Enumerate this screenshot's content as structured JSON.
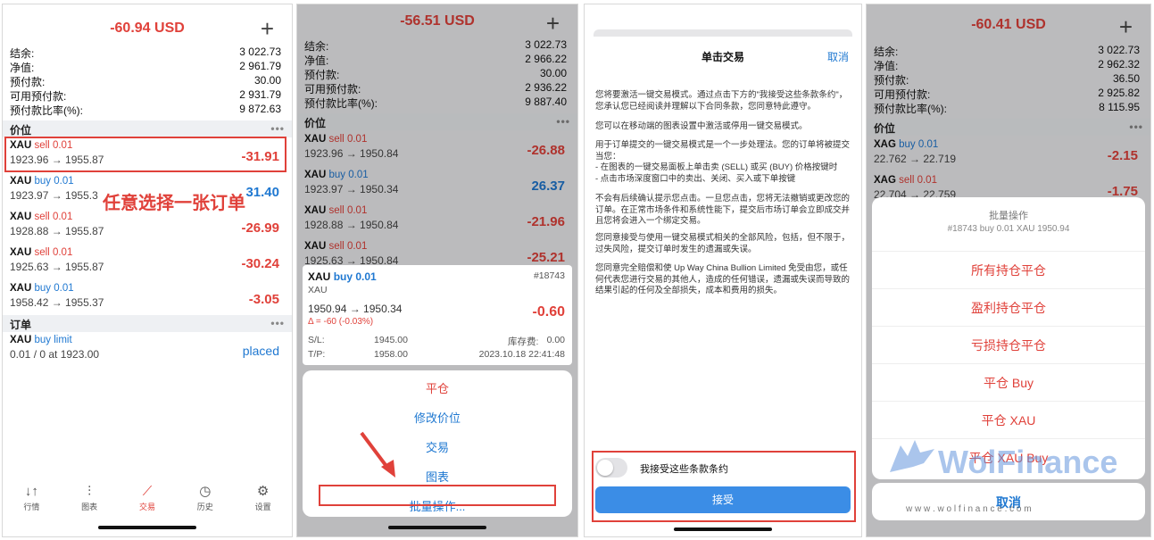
{
  "p1": {
    "title": "-60.94 USD",
    "plus": "+",
    "stats": [
      {
        "k": "结余:",
        "v": "3 022.73"
      },
      {
        "k": "净值:",
        "v": "2 961.79"
      },
      {
        "k": "预付款:",
        "v": "30.00"
      },
      {
        "k": "可用预付款:",
        "v": "2 931.79"
      },
      {
        "k": "预付款比率(%):",
        "v": "9 872.63"
      }
    ],
    "sec_positions": "价位",
    "sec_orders": "订单",
    "dots": "•••",
    "orders": [
      {
        "sym": "XAU",
        "side": "sell",
        "lot": "0.01",
        "prices": "1923.96 → 1955.87",
        "pl": "-31.91"
      },
      {
        "sym": "XAU",
        "side": "buy",
        "lot": "0.01",
        "prices": "1923.97 → 1955.3",
        "pl": "31.40"
      },
      {
        "sym": "XAU",
        "side": "sell",
        "lot": "0.01",
        "prices": "1928.88 → 1955.87",
        "pl": "-26.99"
      },
      {
        "sym": "XAU",
        "side": "sell",
        "lot": "0.01",
        "prices": "1925.63 → 1955.87",
        "pl": "-30.24"
      },
      {
        "sym": "XAU",
        "side": "buy",
        "lot": "0.01",
        "prices": "1958.42 → 1955.37",
        "pl": "-3.05"
      }
    ],
    "annotation": "任意选择一张订单",
    "pending": {
      "sym": "XAU",
      "type": "buy limit",
      "detail": "0.01 / 0 at 1923.00",
      "status": "placed"
    },
    "tabs": [
      {
        "label": "行情",
        "icon": "↓↑"
      },
      {
        "label": "图表",
        "icon": "⫶"
      },
      {
        "label": "交易",
        "icon": "⟋"
      },
      {
        "label": "历史",
        "icon": "◷"
      },
      {
        "label": "设置",
        "icon": "⚙"
      }
    ]
  },
  "p2": {
    "title": "-56.51 USD",
    "plus": "+",
    "stats": [
      {
        "k": "结余:",
        "v": "3 022.73"
      },
      {
        "k": "净值:",
        "v": "2 966.22"
      },
      {
        "k": "预付款:",
        "v": "30.00"
      },
      {
        "k": "可用预付款:",
        "v": "2 936.22"
      },
      {
        "k": "预付款比率(%):",
        "v": "9 887.40"
      }
    ],
    "sec_positions": "价位",
    "dots": "•••",
    "orders": [
      {
        "sym": "XAU",
        "side": "sell",
        "lot": "0.01",
        "prices": "1923.96 → 1950.84",
        "pl": "-26.88"
      },
      {
        "sym": "XAU",
        "side": "buy",
        "lot": "0.01",
        "prices": "1923.97 → 1950.34",
        "pl": "26.37"
      },
      {
        "sym": "XAU",
        "side": "sell",
        "lot": "0.01",
        "prices": "1928.88 → 1950.84",
        "pl": "-21.96"
      },
      {
        "sym": "XAU",
        "side": "sell",
        "lot": "0.01",
        "prices": "1925.63 → 1950.84",
        "pl": "-25.21"
      }
    ],
    "detail": {
      "sym": "XAU",
      "side": "buy",
      "lot": "0.01",
      "id": "#18743",
      "sub": "XAU",
      "prices": "1950.94 → 1950.34",
      "delta": "Δ = -60 (-0.03%)",
      "pl": "-0.60",
      "sl_label": "S/L:",
      "sl": "1945.00",
      "swap_label": "库存费:",
      "swap": "0.00",
      "tp_label": "T/P:",
      "tp": "1958.00",
      "time": "2023.10.18 22:41:48"
    },
    "menu": [
      "平仓",
      "修改价位",
      "交易",
      "图表",
      "批量操作..."
    ]
  },
  "p3": {
    "title": "单击交易",
    "cancel": "取消",
    "paras": [
      "您将要激活一键交易模式。通过点击下方的\"我接受这些条款条约\"，您承认您已经阅读并理解以下合同条款，您同意特此遵守。",
      "您可以在移动端的图表设置中激活或停用一键交易模式。",
      "用于订单提交的一键交易模式是一个一步处理法。您的订单将被提交当您：\n- 在图表的一键交易面板上单击卖 (SELL) 或买 (BUY) 价格按键时\n- 点击市场深度窗口中的卖出、关闭、买入或下单按键",
      "不会有后续确认提示您点击。一旦您点击，您将无法撤销或更改您的订单。在正常市场条件和系统性能下，提交后市场订单会立即成交并且您将会进入一个绑定交易。",
      "您同意接受与使用一键交易模式相关的全部风险，包括，但不限于，过失风险，提交订单时发生的遗漏或失误。",
      "您同意完全赔偿和使 Up Way China Bullion Limited 免受由您，或任何代表您进行交易的其他人，造成的任何错误，遗漏或失误而导致的结果引起的任何及全部损失，成本和费用的损失。"
    ],
    "accept": "我接受这些条款条约",
    "button": "接受"
  },
  "p4": {
    "title": "-60.41 USD",
    "plus": "+",
    "stats": [
      {
        "k": "结余:",
        "v": "3 022.73"
      },
      {
        "k": "净值:",
        "v": "2 962.32"
      },
      {
        "k": "预付款:",
        "v": "36.50"
      },
      {
        "k": "可用预付款:",
        "v": "2 925.82"
      },
      {
        "k": "预付款比率(%):",
        "v": "8 115.95"
      }
    ],
    "sec_positions": "价位",
    "dots": "•••",
    "orders": [
      {
        "sym": "XAG",
        "side": "buy",
        "lot": "0.01",
        "prices": "22.762 → 22.719",
        "pl": "-2.15"
      },
      {
        "sym": "XAG",
        "side": "sell",
        "lot": "0.01",
        "prices": "22.704 → 22.759",
        "pl": "-1.75"
      }
    ],
    "sheet_title": "批量操作",
    "sheet_sub": "#18743 buy 0.01 XAU 1950.94",
    "actions": [
      "所有持仓平仓",
      "盈利持仓平仓",
      "亏损持仓平仓",
      "平仓 Buy",
      "平仓 XAU",
      "平仓 XAU Buy"
    ],
    "cancel": "取消",
    "watermark": "WolFinance",
    "watermark_url": "w w w . w o l f i n a n c e . c o m"
  }
}
